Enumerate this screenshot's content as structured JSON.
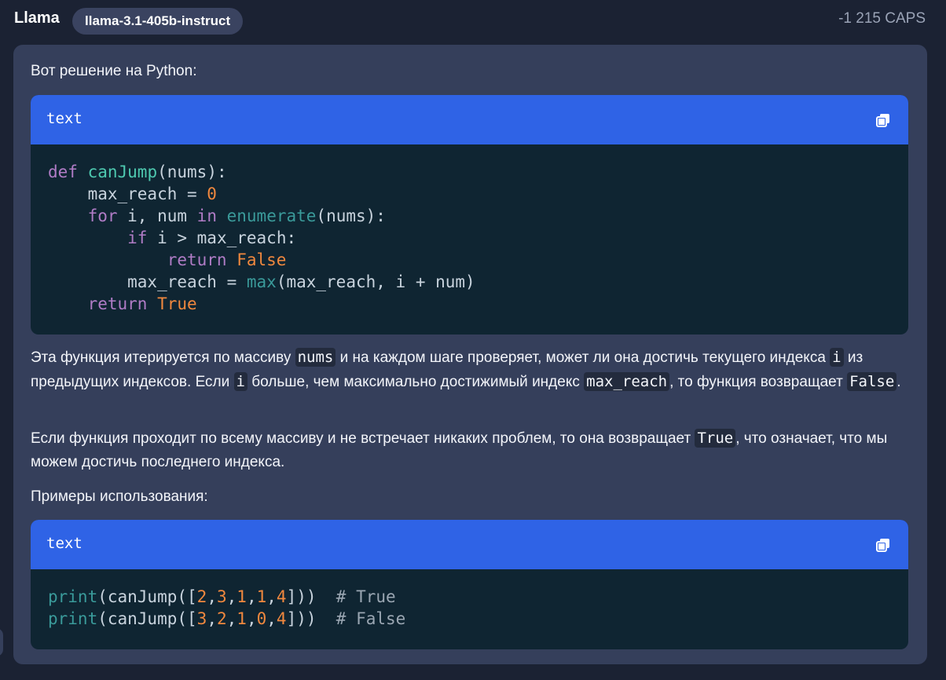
{
  "header": {
    "author": "Llama",
    "model": "llama-3.1-405b-instruct",
    "caps": "-1 215 CAPS"
  },
  "message": {
    "intro": "Вот решение на Python:",
    "code1": {
      "lang": "text",
      "lines": [
        [
          {
            "t": "def",
            "c": "kw"
          },
          {
            "t": " "
          },
          {
            "t": "canJump",
            "c": "fn"
          },
          {
            "t": "(nums):"
          }
        ],
        [
          {
            "t": "    max_reach = "
          },
          {
            "t": "0",
            "c": "num"
          }
        ],
        [
          {
            "t": "    "
          },
          {
            "t": "for",
            "c": "kw"
          },
          {
            "t": " i, num "
          },
          {
            "t": "in",
            "c": "kw"
          },
          {
            "t": " "
          },
          {
            "t": "enumerate",
            "c": "bi"
          },
          {
            "t": "(nums):"
          }
        ],
        [
          {
            "t": "        "
          },
          {
            "t": "if",
            "c": "kw"
          },
          {
            "t": " i > max_reach:"
          }
        ],
        [
          {
            "t": "            "
          },
          {
            "t": "return",
            "c": "kw"
          },
          {
            "t": " "
          },
          {
            "t": "False",
            "c": "cst"
          }
        ],
        [
          {
            "t": "        max_reach = "
          },
          {
            "t": "max",
            "c": "bi"
          },
          {
            "t": "(max_reach, i + num)"
          }
        ],
        [
          {
            "t": "    "
          },
          {
            "t": "return",
            "c": "kw"
          },
          {
            "t": " "
          },
          {
            "t": "True",
            "c": "cst"
          }
        ]
      ]
    },
    "para1": {
      "a": "Эта функция итерируется по массиву ",
      "c1": "nums",
      "b": " и на каждом шаге проверяет, может ли она достичь текущего индекса ",
      "c2": "i",
      "c": " из предыдущих индексов. Если ",
      "c3": "i",
      "d": " больше, чем максимально достижимый индекс ",
      "c4": "max_reach",
      "e": ", то функция возвращает ",
      "c5": "False",
      "f": "."
    },
    "para2": {
      "a": "Если функция проходит по всему массиву и не встречает никаких проблем, то она возвращает ",
      "c1": "True",
      "b": ", что означает, что мы можем достичь последнего индекса."
    },
    "examples_label": "Примеры использования:",
    "code2": {
      "lang": "text",
      "lines": [
        [
          {
            "t": "print",
            "c": "bi"
          },
          {
            "t": "(canJump(["
          },
          {
            "t": "2",
            "c": "num"
          },
          {
            "t": ","
          },
          {
            "t": "3",
            "c": "num"
          },
          {
            "t": ","
          },
          {
            "t": "1",
            "c": "num"
          },
          {
            "t": ","
          },
          {
            "t": "1",
            "c": "num"
          },
          {
            "t": ","
          },
          {
            "t": "4",
            "c": "num"
          },
          {
            "t": "]))  "
          },
          {
            "t": "# True",
            "c": "cm"
          }
        ],
        [
          {
            "t": "print",
            "c": "bi"
          },
          {
            "t": "(canJump(["
          },
          {
            "t": "3",
            "c": "num"
          },
          {
            "t": ","
          },
          {
            "t": "2",
            "c": "num"
          },
          {
            "t": ","
          },
          {
            "t": "1",
            "c": "num"
          },
          {
            "t": ","
          },
          {
            "t": "0",
            "c": "num"
          },
          {
            "t": ","
          },
          {
            "t": "4",
            "c": "num"
          },
          {
            "t": "]))  "
          },
          {
            "t": "# False",
            "c": "cm"
          }
        ]
      ]
    }
  }
}
